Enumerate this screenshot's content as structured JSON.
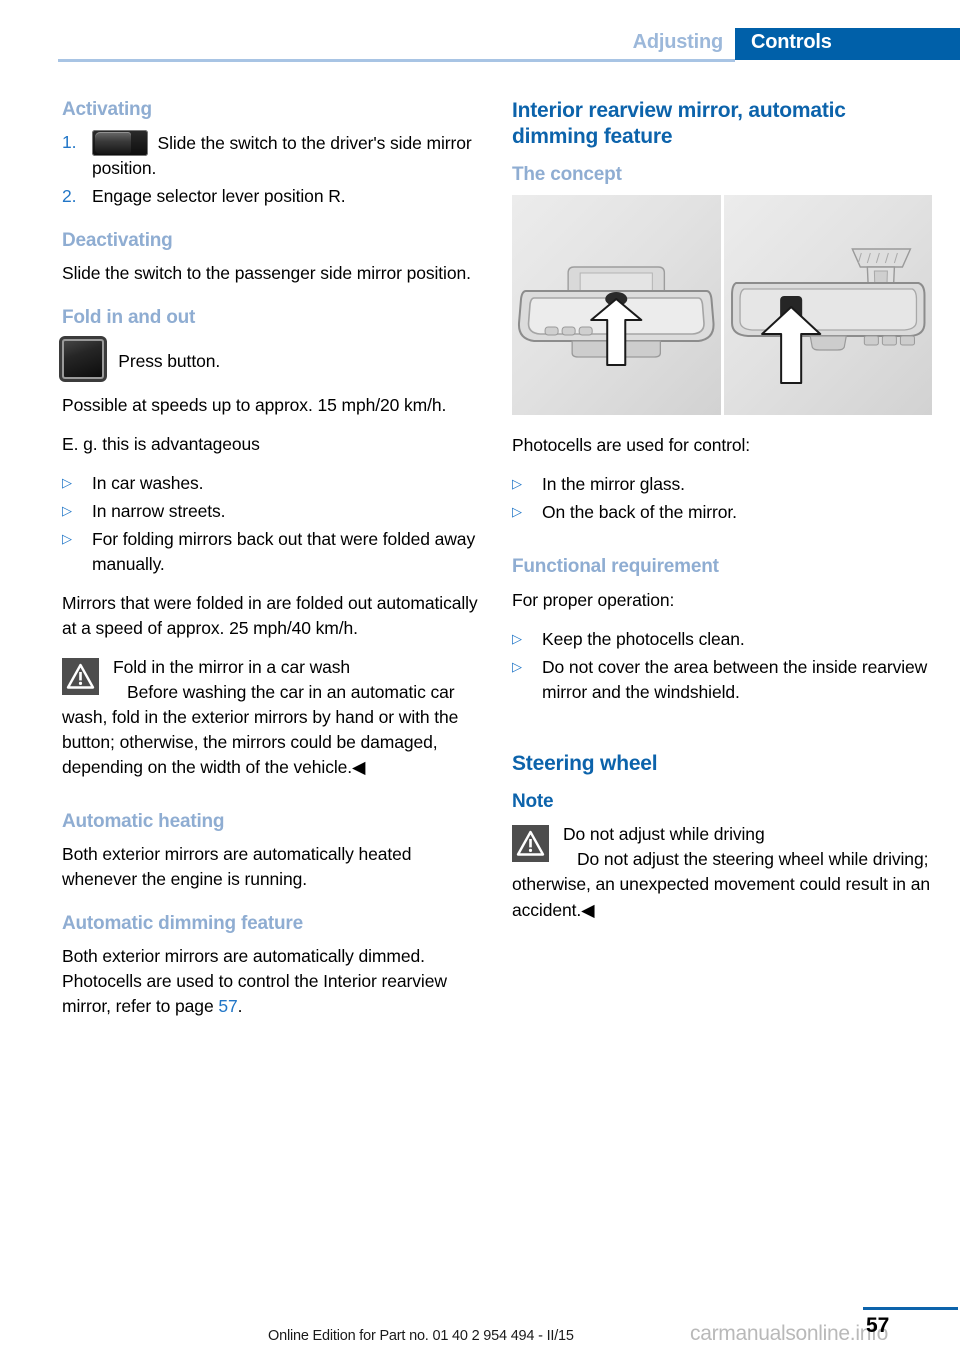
{
  "header": {
    "chapter": "Adjusting",
    "section": "Controls"
  },
  "left_column": {
    "activating": {
      "heading": "Activating",
      "steps": [
        {
          "number": "1.",
          "icon": "rocker-switch-icon",
          "text": "Slide the switch to the driver's side mirror position."
        },
        {
          "number": "2.",
          "text": "Engage selector lever position R."
        }
      ]
    },
    "deactivating": {
      "heading": "Deactivating",
      "text": "Slide the switch to the passenger side mirror position."
    },
    "fold_in_and_out": {
      "heading": "Fold in and out",
      "button_icon": "press-button-icon",
      "button_text": "Press button.",
      "speed_note": "Possible at speeds up to approx. 15 mph/20 km/h.",
      "examples_intro": "E. g. this is advantageous",
      "examples": [
        "In car washes.",
        "In narrow streets.",
        "For folding mirrors back out that were folded away manually."
      ],
      "auto_unfold": "Mirrors that were folded in are folded out automatically at a speed of approx. 25 mph/40 km/h.",
      "warning": {
        "icon": "warning-triangle-icon",
        "title": "Fold in the mirror in a car wash",
        "body": "Before washing the car in an automatic car wash, fold in the exterior mirrors by hand or with the button; otherwise, the mirrors could be damaged, depending on the width of the vehicle.",
        "endmark": "◀"
      }
    },
    "automatic_heating": {
      "heading": "Automatic heating",
      "text": "Both exterior mirrors are automatically heated whenever the engine is running."
    },
    "automatic_dimming": {
      "heading": "Automatic dimming feature",
      "text_before_ref": "Both exterior mirrors are automatically dimmed. Photocells are used to control the Interior rearview mirror, refer to page ",
      "page_ref": "57",
      "text_after_ref": "."
    }
  },
  "right_column": {
    "interior_mirror": {
      "heading": "Interior rearview mirror, automatic dimming feature",
      "concept_heading": "The concept",
      "figure": {
        "name": "interior-rearview-mirror-photocell-illustration",
        "panels": [
          {
            "caption": "mirror front view with photocell in mirror glass"
          },
          {
            "caption": "mirror back view with photocell on back of mirror"
          }
        ]
      },
      "photocells_intro": "Photocells are used for control:",
      "photocell_locations": [
        "In the mirror glass.",
        "On the back of the mirror."
      ]
    },
    "functional_requirement": {
      "heading": "Functional requirement",
      "intro": "For proper operation:",
      "items": [
        "Keep the photocells clean.",
        "Do not cover the area between the inside rearview mirror and the windshield."
      ]
    },
    "steering_wheel": {
      "heading": "Steering wheel",
      "note_heading": "Note",
      "warning": {
        "icon": "warning-triangle-icon",
        "title": "Do not adjust while driving",
        "body": "Do not adjust the steering wheel while driving; otherwise, an unexpected movement could result in an accident.",
        "endmark": "◀"
      }
    }
  },
  "footer": {
    "edition": "Online Edition for Part no. 01 40 2 954 494 - II/15",
    "watermark": "carmanualsonline.info",
    "page_number": "57"
  },
  "colors": {
    "banner_blue": "#0060a9",
    "heading_blue": "#0c63ab",
    "subheading_blue": "#8fadd2",
    "chapter_blue": "#9cb8da",
    "link_blue": "#2176c7",
    "warning_gray": "#4d4d4d"
  }
}
